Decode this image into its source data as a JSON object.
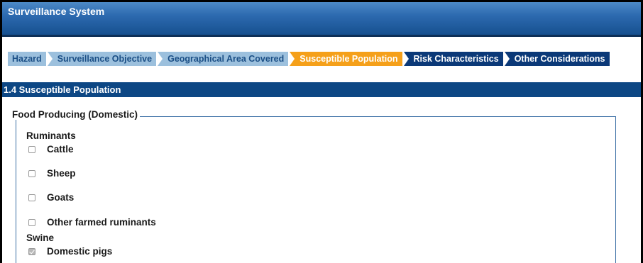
{
  "header": {
    "title": "Surveillance System"
  },
  "tabs": [
    {
      "label": "Hazard",
      "state": "done"
    },
    {
      "label": "Surveillance Objective",
      "state": "done"
    },
    {
      "label": "Geographical Area Covered",
      "state": "done"
    },
    {
      "label": "Susceptible Population",
      "state": "current"
    },
    {
      "label": "Risk Characteristics",
      "state": "pending"
    },
    {
      "label": "Other Considerations",
      "state": "pending"
    }
  ],
  "section": {
    "title": "1.4 Susceptible Population"
  },
  "fieldset": {
    "legend": "Food Producing (Domestic)",
    "groups": [
      {
        "label": "Ruminants",
        "options": [
          {
            "label": "Cattle",
            "checked": false
          },
          {
            "label": "Sheep",
            "checked": false
          },
          {
            "label": "Goats",
            "checked": false
          },
          {
            "label": "Other farmed ruminants",
            "checked": false
          }
        ]
      },
      {
        "label": "Swine",
        "options": [
          {
            "label": "Domestic pigs",
            "checked": true
          }
        ]
      }
    ]
  },
  "colors": {
    "title_bar": "#2d6ab0",
    "tab_done": "#9cc0dd",
    "tab_current": "#f5a01a",
    "tab_pending": "#0b3978",
    "section_header": "#0d4784"
  }
}
